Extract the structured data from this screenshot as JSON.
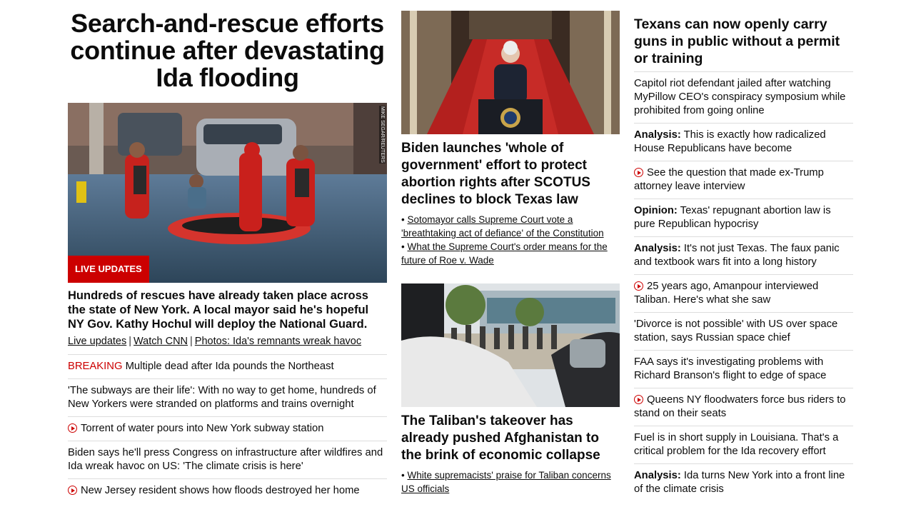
{
  "lead": {
    "title": "Search-and-rescue efforts continue after devastating Ida flooding",
    "badge": "LIVE UPDATES",
    "photo_credit": "MIKE SEGAR/REUTERS",
    "summary": "Hundreds of rescues have already taken place across the state of New York. A local mayor said he's hopeful NY Gov. Kathy Hochul will deploy the National Guard.",
    "links": [
      "Live updates",
      "Watch CNN",
      "Photos: Ida's remnants wreak havoc"
    ],
    "separator": "|"
  },
  "left_list": [
    {
      "prefix": "BREAKING",
      "text": " Multiple dead after Ida pounds the Northeast",
      "video": false
    },
    {
      "prefix": "",
      "text": "'The subways are their life': With no way to get home, hundreds of New Yorkers were stranded on platforms and trains overnight",
      "video": false
    },
    {
      "prefix": "",
      "text": "Torrent of water pours into New York subway station",
      "video": true
    },
    {
      "prefix": "",
      "text": "Biden says he'll press Congress on infrastructure after wildfires and Ida wreak havoc on US: 'The climate crisis is here'",
      "video": false
    },
    {
      "prefix": "",
      "text": "New Jersey resident shows how floods destroyed her home",
      "video": true
    }
  ],
  "middle": {
    "story1": {
      "headline": "Biden launches 'whole of government' effort to protect abortion rights after SCOTUS declines to block Texas law",
      "subs": [
        "Sotomayor calls Supreme Court vote a 'breathtaking act of defiance' of the Constitution",
        "What the Supreme Court's order means for the future of Roe v. Wade"
      ]
    },
    "story2": {
      "headline": "The Taliban's takeover has already pushed Afghanistan to the brink of economic collapse",
      "subs": [
        "White supremacists' praise for Taliban concerns US officials"
      ]
    },
    "bullet": "•"
  },
  "right": {
    "headline": "Texans can now openly carry guns in public without a permit or training",
    "items": [
      {
        "prefix": "",
        "text": "Capitol riot defendant jailed after watching MyPillow CEO's conspiracy symposium while prohibited from going online",
        "video": false
      },
      {
        "prefix": "Analysis:",
        "text": " This is exactly how radicalized House Republicans have become",
        "video": false
      },
      {
        "prefix": "",
        "text": "See the question that made ex-Trump attorney leave interview",
        "video": true
      },
      {
        "prefix": "Opinion:",
        "text": " Texas' repugnant abortion law is pure Republican hypocrisy",
        "video": false
      },
      {
        "prefix": "Analysis:",
        "text": " It's not just Texas. The faux panic and textbook wars fit into a long history",
        "video": false
      },
      {
        "prefix": "",
        "text": "25 years ago, Amanpour interviewed Taliban. Here's what she saw",
        "video": true
      },
      {
        "prefix": "",
        "text": "'Divorce is not possible' with US over space station, says Russian space chief",
        "video": false
      },
      {
        "prefix": "",
        "text": "FAA says it's investigating problems with Richard Branson's flight to edge of space",
        "video": false
      },
      {
        "prefix": "",
        "text": "Queens NY floodwaters force bus riders to stand on their seats",
        "video": true
      },
      {
        "prefix": "",
        "text": "Fuel is in short supply in Louisiana. That's a critical problem for the Ida recovery effort",
        "video": false
      },
      {
        "prefix": "Analysis:",
        "text": " Ida turns New York into a front line of the climate crisis",
        "video": false
      }
    ]
  },
  "colors": {
    "accent": "#cc0000",
    "divider": "#dddddd",
    "text": "#0c0c0c"
  }
}
